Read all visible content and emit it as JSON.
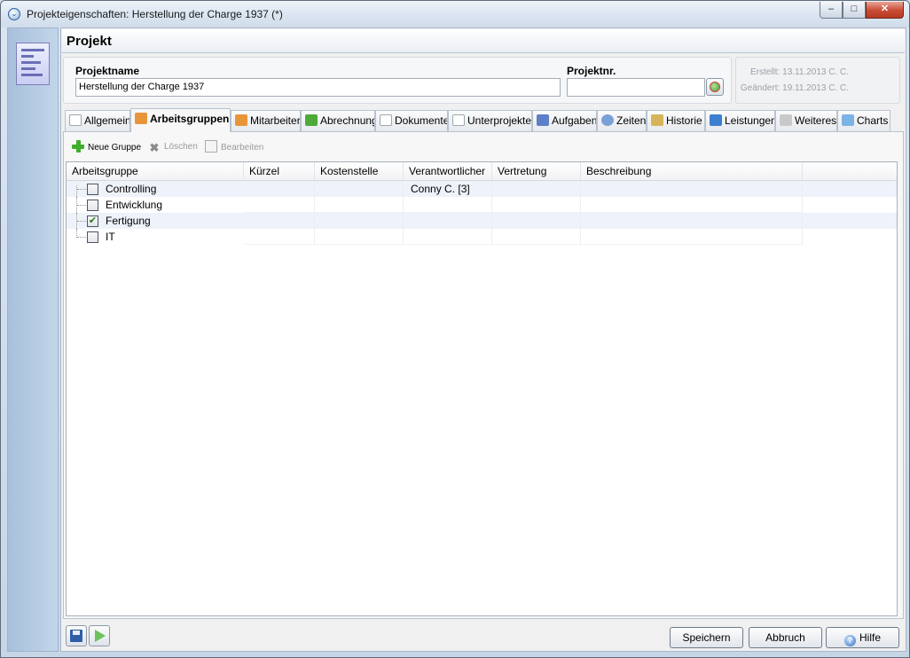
{
  "window": {
    "title": "Projekteigenschaften: Herstellung der Charge 1937 (*)",
    "controls": {
      "minimize": "–",
      "maximize": "□",
      "close": "✕"
    }
  },
  "header": {
    "title": "Projekt"
  },
  "fields": {
    "projektname_label": "Projektname",
    "projektname_value": "Herstellung der Charge 1937",
    "projektnr_label": "Projektnr.",
    "projektnr_value": ""
  },
  "meta": {
    "erstellt": "Erstellt: 13.11.2013  C. C.",
    "geaendert": "Geändert: 19.11.2013  C. C."
  },
  "tabs": [
    {
      "label": "Allgemein",
      "icon": "document-icon",
      "color": "#ffffff"
    },
    {
      "label": "Arbeitsgruppen",
      "icon": "group-icon",
      "color": "#e8953a",
      "active": true
    },
    {
      "label": "Mitarbeiter",
      "icon": "people-icon",
      "color": "#e8953a"
    },
    {
      "label": "Abrechnung",
      "icon": "money-icon",
      "color": "#4cab38"
    },
    {
      "label": "Dokumente",
      "icon": "documents-icon",
      "color": "#ffffff"
    },
    {
      "label": "Unterprojekte",
      "icon": "subproject-icon",
      "color": "#ffffff"
    },
    {
      "label": "Aufgaben",
      "icon": "tasks-icon",
      "color": "#5b7fc8"
    },
    {
      "label": "Zeiten",
      "icon": "clock-icon",
      "color": "#7aa0d8"
    },
    {
      "label": "Historie",
      "icon": "history-icon",
      "color": "#d6b45a"
    },
    {
      "label": "Leistungen",
      "icon": "services-icon",
      "color": "#3d7fd0"
    },
    {
      "label": "Weiteres",
      "icon": "more-icon",
      "color": "#c9c9c9"
    },
    {
      "label": "Charts",
      "icon": "chart-icon",
      "color": "#7bb3e6"
    }
  ],
  "toolbar": {
    "new_group": "Neue Gruppe",
    "delete": "Löschen",
    "edit": "Bearbeiten"
  },
  "grid": {
    "columns": [
      "Arbeitsgruppe",
      "Kürzel",
      "Kostenstelle",
      "Verantwortlicher",
      "Vertretung",
      "Beschreibung"
    ],
    "rows": [
      {
        "name": "Controlling",
        "kuerzel": "",
        "kostenstelle": "",
        "verantwortlicher": "Conny C. [3]",
        "vertretung": "",
        "beschreibung": "",
        "checked": false
      },
      {
        "name": "Entwicklung",
        "kuerzel": "",
        "kostenstelle": "",
        "verantwortlicher": "",
        "vertretung": "",
        "beschreibung": "",
        "checked": false
      },
      {
        "name": "Fertigung",
        "kuerzel": "",
        "kostenstelle": "",
        "verantwortlicher": "",
        "vertretung": "",
        "beschreibung": "",
        "checked": true
      },
      {
        "name": "IT",
        "kuerzel": "",
        "kostenstelle": "",
        "verantwortlicher": "",
        "vertretung": "",
        "beschreibung": "",
        "checked": false
      }
    ]
  },
  "buttons": {
    "speichern": "Speichern",
    "abbruch": "Abbruch",
    "hilfe": "Hilfe"
  },
  "colors": {
    "accent": "#2f6fc5",
    "row_highlight": "#eef2fa",
    "check_mark": "#1c7d1c"
  }
}
